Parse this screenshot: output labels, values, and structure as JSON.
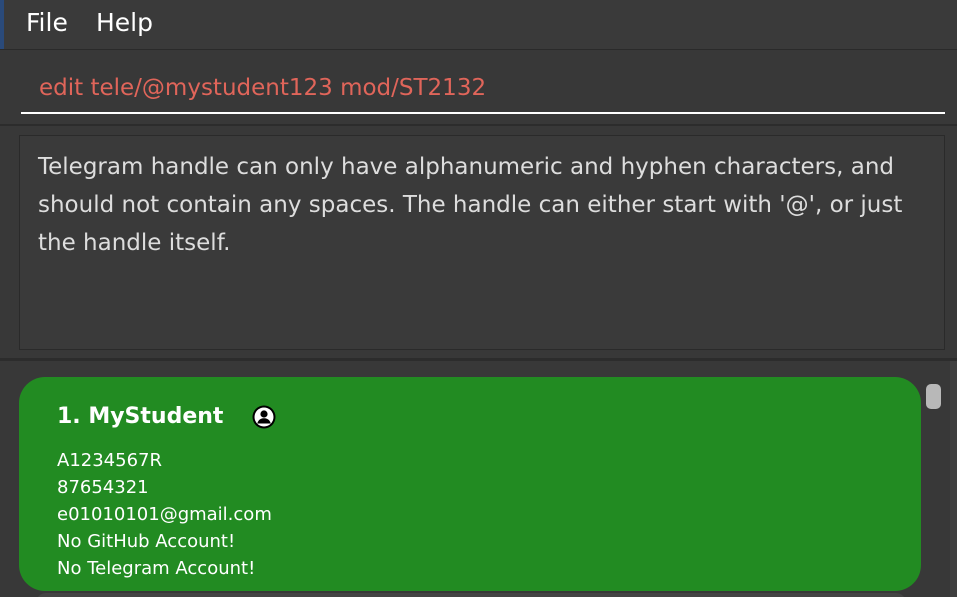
{
  "menu": {
    "file_label": "File",
    "help_label": "Help"
  },
  "command": {
    "value": "edit tele/@mystudent123 mod/ST2132",
    "error_color": "#e0655a"
  },
  "result": {
    "message": "Telegram handle can only have alphanumeric and hyphen characters, and should not contain any spaces. The handle can either start with '@', or just the handle itself."
  },
  "persons": [
    {
      "name": "1. MyStudent",
      "student_id": "A1234567R",
      "phone": "87654321",
      "email": "e01010101@gmail.com",
      "github": "No GitHub Account!",
      "telegram": "No Telegram Account!",
      "icon": "user-avatar-icon",
      "card_color": "#228b22"
    }
  ]
}
